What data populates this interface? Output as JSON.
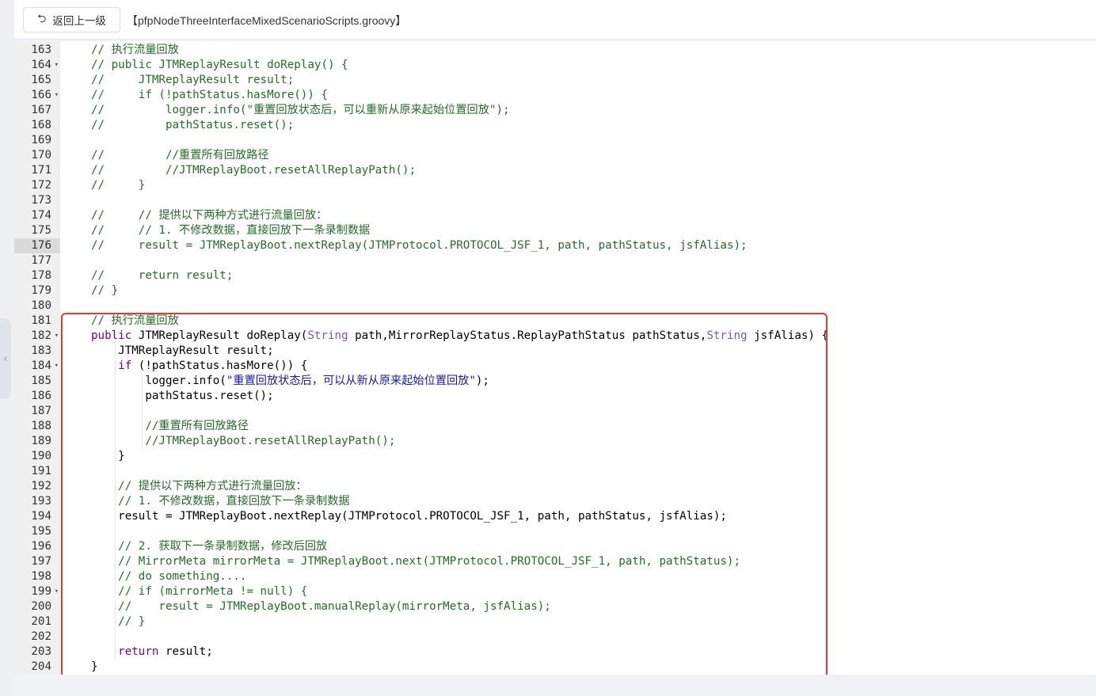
{
  "header": {
    "back_icon": "return-arrow-icon",
    "back_label": "返回上一级",
    "file_title": "【pfpNodeThreeInterfaceMixedScenarioScripts.groovy】"
  },
  "sidebar": {
    "collapse_icon": "‹"
  },
  "editor": {
    "active_line": 176,
    "lines": [
      {
        "n": 163,
        "fold": false,
        "t": [
          [
            "c",
            "// 执行流量回放"
          ]
        ]
      },
      {
        "n": 164,
        "fold": true,
        "t": [
          [
            "c",
            "// public JTMReplayResult doReplay() {"
          ]
        ]
      },
      {
        "n": 165,
        "fold": false,
        "t": [
          [
            "c",
            "//     JTMReplayResult result;"
          ]
        ]
      },
      {
        "n": 166,
        "fold": true,
        "t": [
          [
            "c",
            "//     if (!pathStatus.hasMore()) {"
          ]
        ]
      },
      {
        "n": 167,
        "fold": false,
        "t": [
          [
            "c",
            "//         logger.info(\"重置回放状态后，可以重新从原来起始位置回放\");"
          ]
        ]
      },
      {
        "n": 168,
        "fold": false,
        "t": [
          [
            "c",
            "//         pathStatus.reset();"
          ]
        ]
      },
      {
        "n": 169,
        "fold": false,
        "t": []
      },
      {
        "n": 170,
        "fold": false,
        "t": [
          [
            "c",
            "//         //重置所有回放路径"
          ]
        ]
      },
      {
        "n": 171,
        "fold": false,
        "t": [
          [
            "c",
            "//         //JTMReplayBoot.resetAllReplayPath();"
          ]
        ]
      },
      {
        "n": 172,
        "fold": false,
        "t": [
          [
            "c",
            "//     }"
          ]
        ]
      },
      {
        "n": 173,
        "fold": false,
        "t": []
      },
      {
        "n": 174,
        "fold": false,
        "t": [
          [
            "c",
            "//     // 提供以下两种方式进行流量回放："
          ]
        ]
      },
      {
        "n": 175,
        "fold": false,
        "t": [
          [
            "c",
            "//     // 1. 不修改数据，直接回放下一条录制数据"
          ]
        ]
      },
      {
        "n": 176,
        "fold": false,
        "t": [
          [
            "c",
            "//     result = JTMReplayBoot.nextReplay(JTMProtocol.PROTOCOL_JSF_1, path, pathStatus, jsfAlias);"
          ]
        ]
      },
      {
        "n": 177,
        "fold": false,
        "t": []
      },
      {
        "n": 178,
        "fold": false,
        "t": [
          [
            "c",
            "//     return result;"
          ]
        ]
      },
      {
        "n": 179,
        "fold": false,
        "t": [
          [
            "c",
            "// }"
          ]
        ]
      },
      {
        "n": 180,
        "fold": false,
        "t": []
      },
      {
        "n": 181,
        "fold": false,
        "t": [
          [
            "c",
            "// 执行流量回放"
          ]
        ]
      },
      {
        "n": 182,
        "fold": true,
        "t": [
          [
            "k",
            "public"
          ],
          [
            "p",
            " JTMReplayResult doReplay("
          ],
          [
            "y",
            "String"
          ],
          [
            "p",
            " path,MirrorReplayStatus.ReplayPathStatus pathStatus,"
          ],
          [
            "y",
            "String"
          ],
          [
            "p",
            " jsfAlias) {"
          ]
        ]
      },
      {
        "n": 183,
        "fold": false,
        "t": [
          [
            "p",
            "    JTMReplayResult result;"
          ]
        ]
      },
      {
        "n": 184,
        "fold": true,
        "t": [
          [
            "p",
            "    "
          ],
          [
            "k",
            "if"
          ],
          [
            "p",
            " (!pathStatus.hasMore()) {"
          ]
        ]
      },
      {
        "n": 185,
        "fold": false,
        "t": [
          [
            "p",
            "        logger.info("
          ],
          [
            "s",
            "\"重置回放状态后，可以从新从原来起始位置回放\""
          ],
          [
            "p",
            ");"
          ]
        ]
      },
      {
        "n": 186,
        "fold": false,
        "t": [
          [
            "p",
            "        pathStatus.reset();"
          ]
        ]
      },
      {
        "n": 187,
        "fold": false,
        "t": []
      },
      {
        "n": 188,
        "fold": false,
        "t": [
          [
            "p",
            "        "
          ],
          [
            "c",
            "//重置所有回放路径"
          ]
        ]
      },
      {
        "n": 189,
        "fold": false,
        "t": [
          [
            "p",
            "        "
          ],
          [
            "c",
            "//JTMReplayBoot.resetAllReplayPath();"
          ]
        ]
      },
      {
        "n": 190,
        "fold": false,
        "t": [
          [
            "p",
            "    }"
          ]
        ]
      },
      {
        "n": 191,
        "fold": false,
        "t": []
      },
      {
        "n": 192,
        "fold": false,
        "t": [
          [
            "p",
            "    "
          ],
          [
            "c",
            "// 提供以下两种方式进行流量回放："
          ]
        ]
      },
      {
        "n": 193,
        "fold": false,
        "t": [
          [
            "p",
            "    "
          ],
          [
            "c",
            "// 1. 不修改数据，直接回放下一条录制数据"
          ]
        ]
      },
      {
        "n": 194,
        "fold": false,
        "t": [
          [
            "p",
            "    result = JTMReplayBoot.nextReplay(JTMProtocol.PROTOCOL_JSF_1, path, pathStatus, jsfAlias);"
          ]
        ]
      },
      {
        "n": 195,
        "fold": false,
        "t": []
      },
      {
        "n": 196,
        "fold": false,
        "t": [
          [
            "p",
            "    "
          ],
          [
            "c",
            "// 2. 获取下一条录制数据，修改后回放"
          ]
        ]
      },
      {
        "n": 197,
        "fold": false,
        "t": [
          [
            "p",
            "    "
          ],
          [
            "c",
            "// MirrorMeta mirrorMeta = JTMReplayBoot.next(JTMProtocol.PROTOCOL_JSF_1, path, pathStatus);"
          ]
        ]
      },
      {
        "n": 198,
        "fold": false,
        "t": [
          [
            "p",
            "    "
          ],
          [
            "c",
            "// do something...."
          ]
        ]
      },
      {
        "n": 199,
        "fold": true,
        "t": [
          [
            "p",
            "    "
          ],
          [
            "c",
            "// if (mirrorMeta != null) {"
          ]
        ]
      },
      {
        "n": 200,
        "fold": false,
        "t": [
          [
            "p",
            "    "
          ],
          [
            "c",
            "//    result = JTMReplayBoot.manualReplay(mirrorMeta, jsfAlias);"
          ]
        ]
      },
      {
        "n": 201,
        "fold": false,
        "t": [
          [
            "p",
            "    "
          ],
          [
            "c",
            "// }"
          ]
        ]
      },
      {
        "n": 202,
        "fold": false,
        "t": []
      },
      {
        "n": 203,
        "fold": false,
        "t": [
          [
            "p",
            "    "
          ],
          [
            "k",
            "return"
          ],
          [
            "p",
            " result;"
          ]
        ]
      },
      {
        "n": 204,
        "fold": false,
        "t": [
          [
            "p",
            "}"
          ]
        ]
      }
    ]
  },
  "colors": {
    "comment": "#236e25",
    "keyword": "#770088",
    "type": "#7a5aa0",
    "string": "#1a1aa6",
    "highlight_border": "#e53935"
  }
}
